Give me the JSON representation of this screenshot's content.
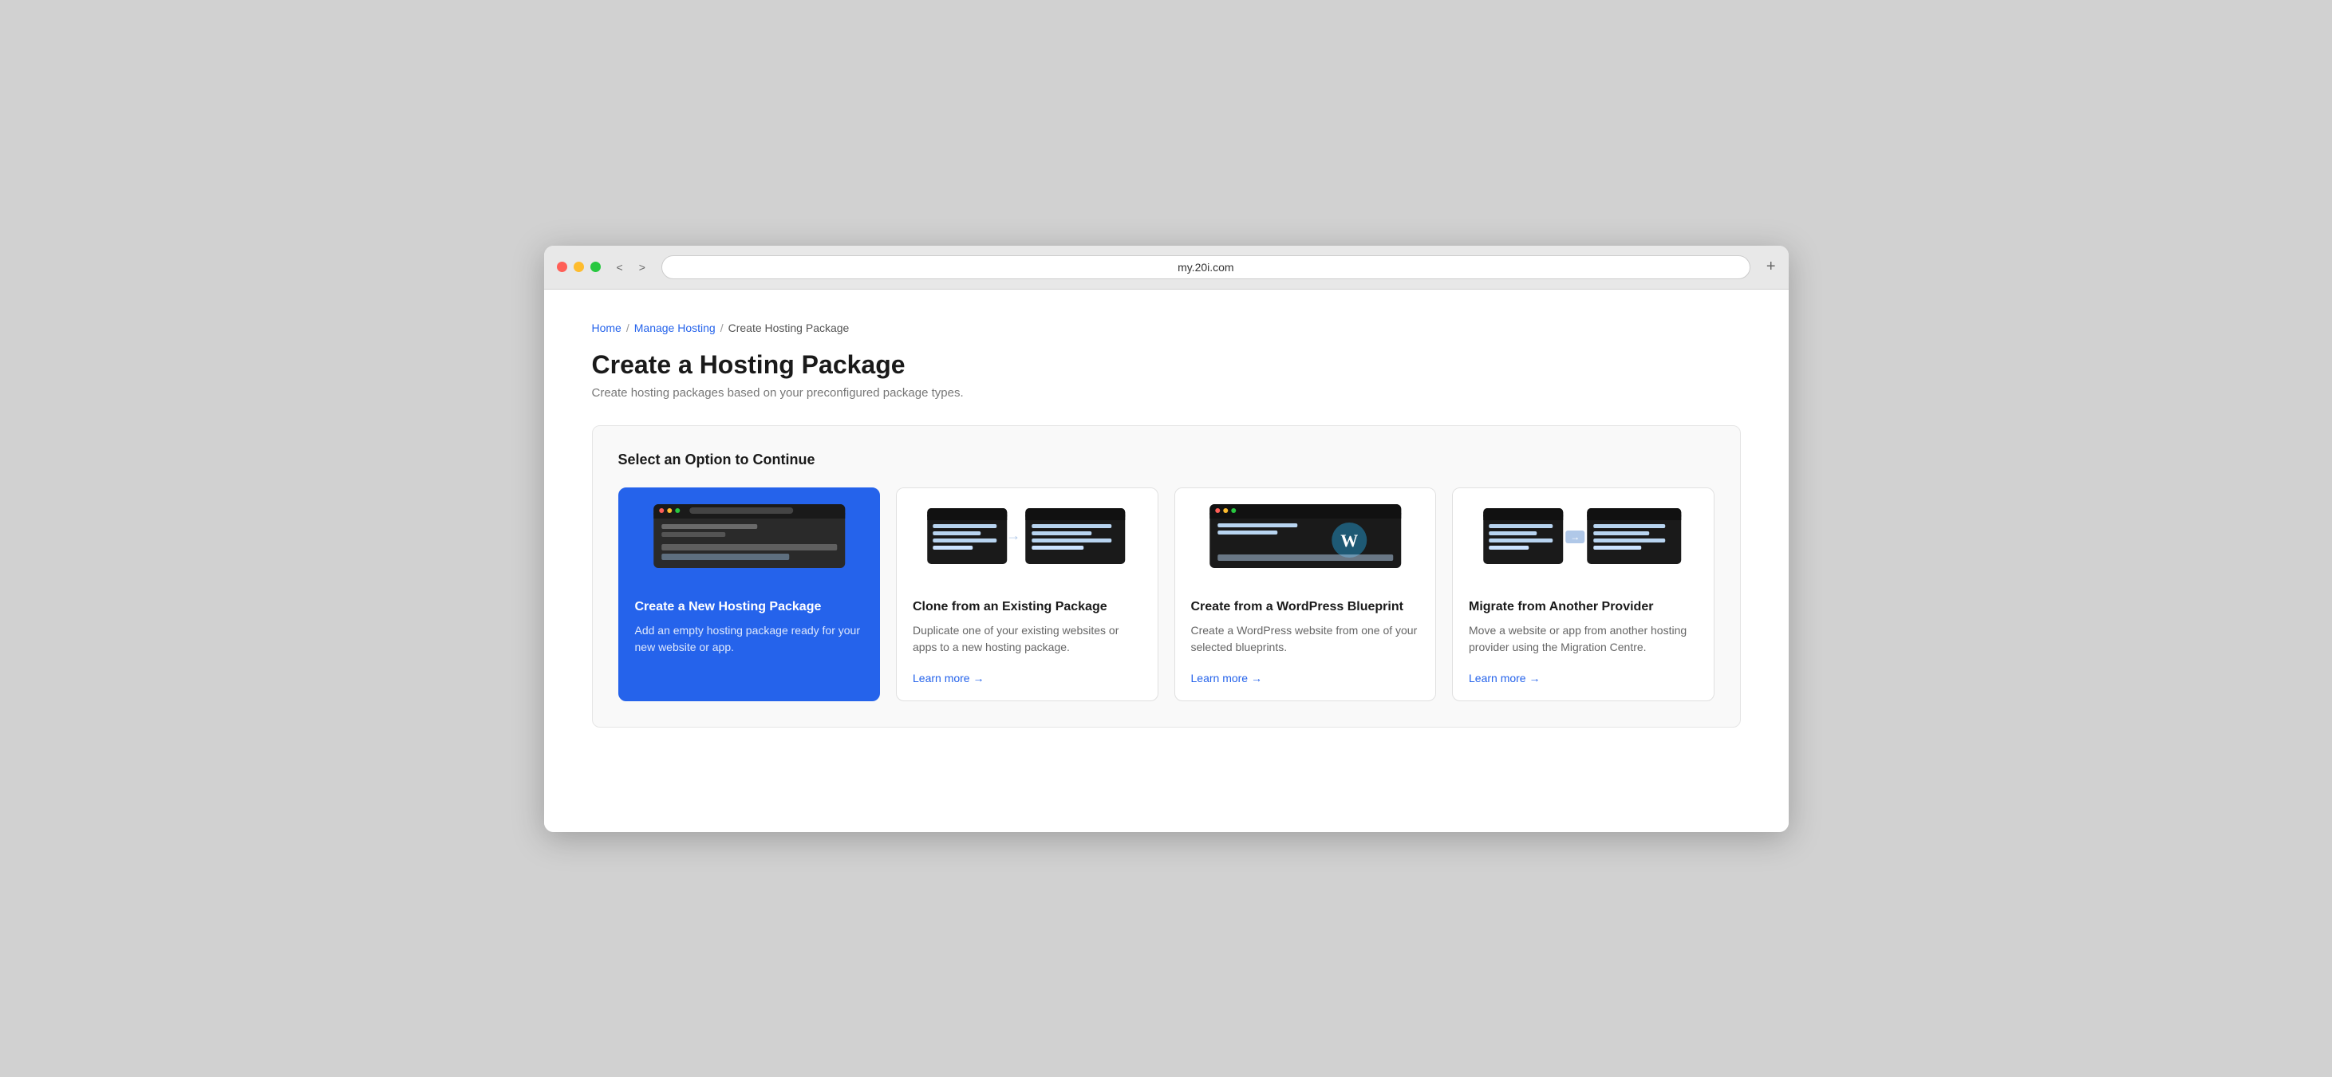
{
  "browser": {
    "url": "my.20i.com",
    "nav_back": "<",
    "nav_forward": ">",
    "new_tab": "+"
  },
  "breadcrumb": {
    "home": "Home",
    "sep1": "/",
    "manage_hosting": "Manage Hosting",
    "sep2": "/",
    "current": "Create Hosting Package"
  },
  "page": {
    "title": "Create a Hosting Package",
    "subtitle": "Create hosting packages based on your preconfigured package types."
  },
  "options_section": {
    "title": "Select an Option to Continue"
  },
  "cards": [
    {
      "id": "new-package",
      "primary": true,
      "title": "Create a New Hosting Package",
      "desc": "Add an empty hosting package ready for your new website or app.",
      "has_link": false,
      "link_text": ""
    },
    {
      "id": "clone-package",
      "primary": false,
      "title": "Clone from an Existing Package",
      "desc": "Duplicate one of your existing websites or apps to a new hosting package.",
      "has_link": true,
      "link_text": "Learn more →"
    },
    {
      "id": "wordpress-blueprint",
      "primary": false,
      "title": "Create from a WordPress Blueprint",
      "desc": "Create a WordPress website from one of your selected blueprints.",
      "has_link": true,
      "link_text": "Learn more →"
    },
    {
      "id": "migrate-provider",
      "primary": false,
      "title": "Migrate from Another Provider",
      "desc": "Move a website or app from another hosting provider using the Migration Centre.",
      "has_link": true,
      "link_text": "Learn more →"
    }
  ],
  "colors": {
    "primary_blue": "#2563eb",
    "link_blue": "#2563eb",
    "text_dark": "#1a1a1a",
    "text_muted": "#666",
    "border": "#e0e0e0"
  }
}
